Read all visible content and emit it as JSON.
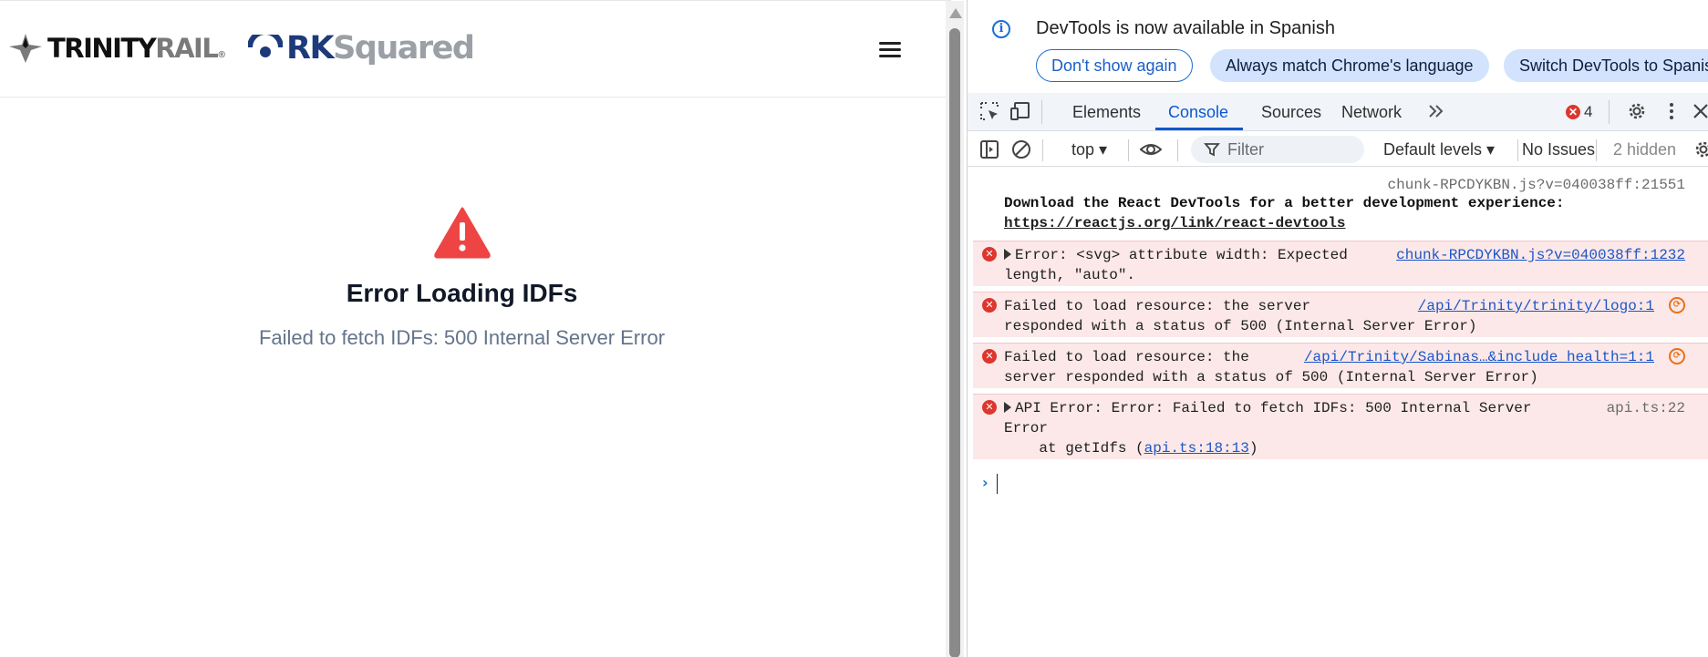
{
  "app": {
    "brand_trinity_main": "TRINITY",
    "brand_trinity_accent": "RAIL",
    "brand_trinity_tm": "®",
    "brand_rk_main": "RK",
    "brand_rk_accent": "Squared",
    "error_title": "Error Loading IDFs",
    "error_message": "Failed to fetch IDFs: 500 Internal Server Error",
    "icons": {
      "menu": "hamburger-menu-icon",
      "warning": "warning-triangle-icon"
    },
    "colors": {
      "warning": "#ef4444",
      "brand_blue": "#1d3a7a"
    }
  },
  "devtools": {
    "infobar": {
      "text": "DevTools is now available in Spanish",
      "buttons": [
        "Don't show again",
        "Always match Chrome's language",
        "Switch DevTools to Spanis"
      ]
    },
    "tabs": [
      "Elements",
      "Console",
      "Sources",
      "Network"
    ],
    "active_tab": "Console",
    "error_count": "4",
    "toolbar": {
      "context": "top ▾",
      "filter_placeholder": "Filter",
      "levels": "Default levels ▾",
      "issues": "No Issues",
      "hidden": "2 hidden"
    },
    "messages": [
      {
        "type": "log",
        "source": "chunk-RPCDYKBN.js?v=040038ff:21551",
        "line1": "Download the React DevTools for a better development experience:",
        "link": "https://reactjs.org/link/react-devtools"
      },
      {
        "type": "error",
        "source": "chunk-RPCDYKBN.js?v=040038ff:1232",
        "line1": "Error: <svg> attribute width: Expected",
        "line2": "length, \"auto\"."
      },
      {
        "type": "error",
        "source": "/api/Trinity/trinity/logo:1",
        "line1": "Failed to load resource: the server",
        "line2": "responded with a status of 500 (Internal Server Error)"
      },
      {
        "type": "error",
        "source": "/api/Trinity/Sabinas…&include_health=1:1",
        "line1": "Failed to load resource: the",
        "line2": "server responded with a status of 500 (Internal Server Error)"
      },
      {
        "type": "error",
        "source": "api.ts:22",
        "line1": "API Error: Error: Failed to fetch IDFs: 500 Internal Server",
        "line2": "Error",
        "line3_prefix": "    at getIdfs (",
        "line3_link": "api.ts:18:13",
        "line3_suffix": ")"
      }
    ],
    "prompt_symbol": "›"
  }
}
